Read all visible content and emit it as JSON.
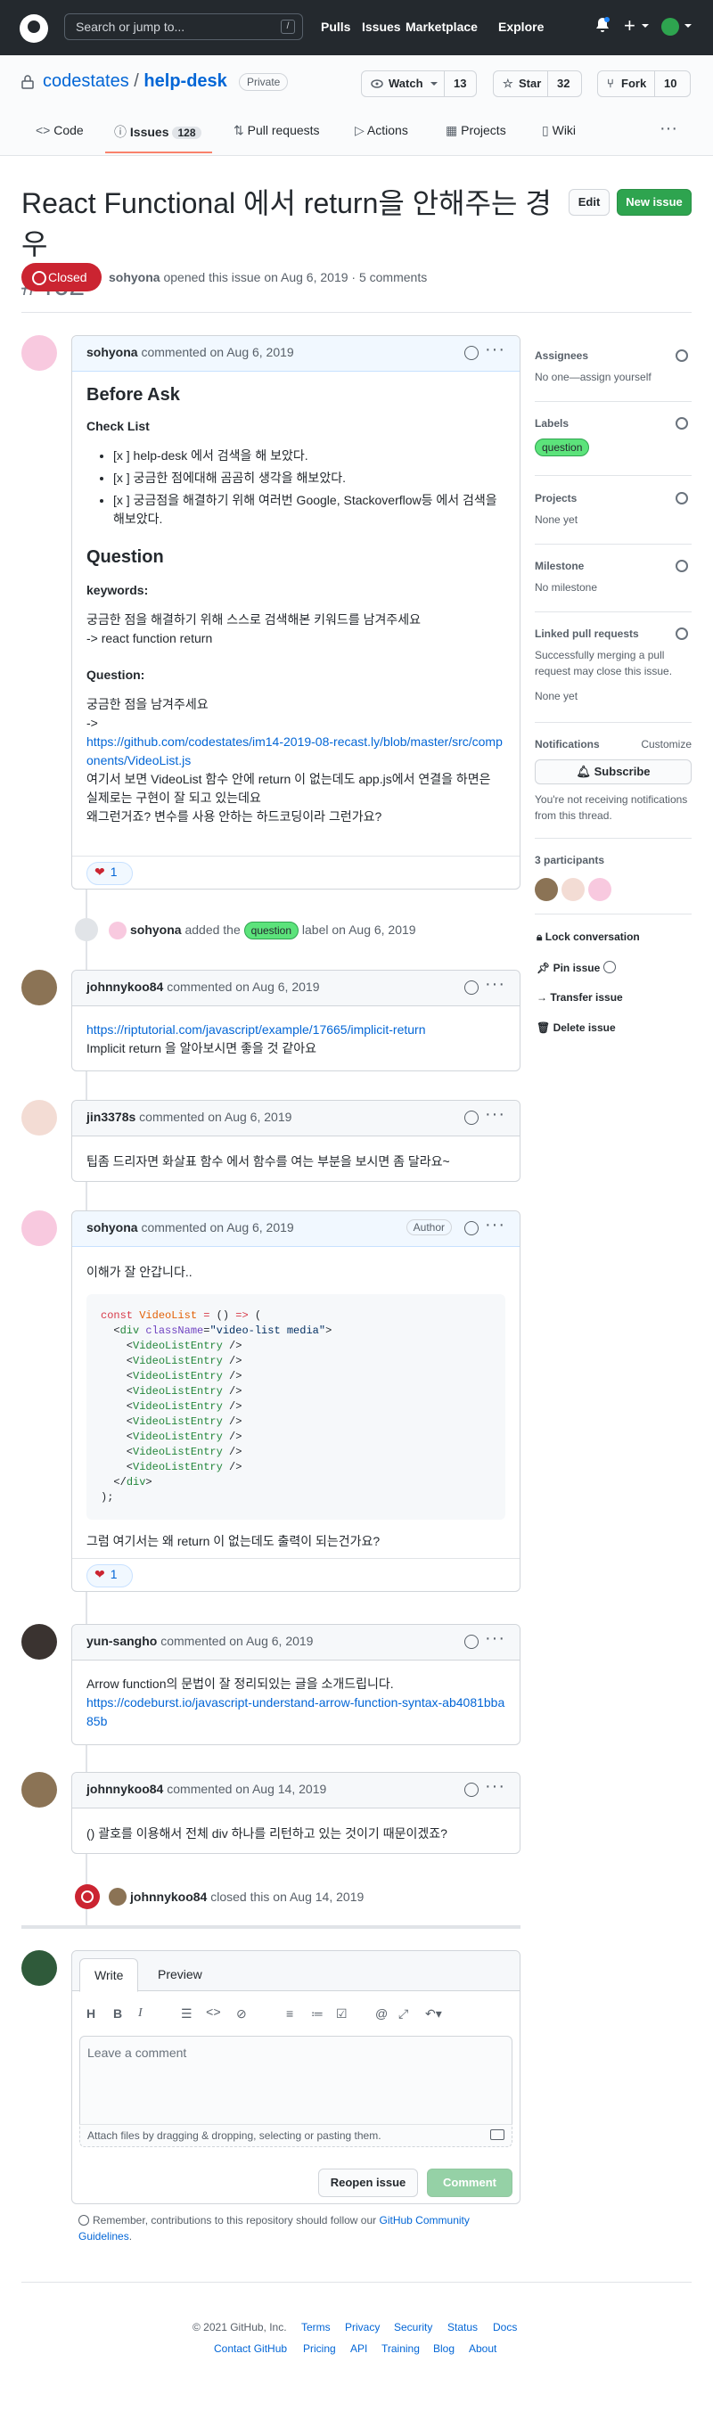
{
  "header": {
    "search_placeholder": "Search or jump to...",
    "search_key": "/",
    "nav": [
      "Pulls",
      "Issues",
      "Marketplace",
      "Explore"
    ]
  },
  "repo": {
    "owner": "codestates",
    "sep": "/",
    "name": "help-desk",
    "visibility": "Private",
    "watch_label": "Watch",
    "watch_count": "13",
    "star_label": "Star",
    "star_count": "32",
    "fork_label": "Fork",
    "fork_count": "10",
    "tabs": {
      "code": "Code",
      "issues": "Issues",
      "issues_count": "128",
      "pulls": "Pull requests",
      "actions": "Actions",
      "projects": "Projects",
      "wiki": "Wiki"
    }
  },
  "issue": {
    "title": "React Functional 에서 return을 안해주는 경우",
    "number": "#462",
    "edit": "Edit",
    "new_issue": "New issue",
    "state": "Closed",
    "meta_author": "sohyona",
    "meta_rest": " opened this issue on Aug 6, 2019 · 5 comments"
  },
  "comments": {
    "c1": {
      "author": "sohyona",
      "meta": " commented on Aug 6, 2019",
      "h_before": "Before Ask",
      "h_checklist": "Check List",
      "checks": [
        "[x ] help-desk 에서 검색을 해 보았다.",
        "[x ] 궁금한 점에대해 곰곰히 생각을 해보았다.",
        "[x ] 궁금점을 해결하기 위해 여러번 Google, Stackoverflow등 에서 검색을 해보았다."
      ],
      "h_question": "Question",
      "h_keywords": "keywords:",
      "kw_line1": "궁금한 점을 해결하기 위해 스스로 검색해본 키워드를 남겨주세요",
      "kw_line2": "-> react function return",
      "h_question2": "Question:",
      "q_line1": "궁금한 점을 남겨주세요",
      "q_line2": "->",
      "q_link": "https://github.com/codestates/im14-2019-08-recast.ly/blob/master/src/components/VideoList.js",
      "q_line3": "여기서 보면 VideoList 함수 안에 return 이 없는데도 app.js에서 연결을 하면은 실제로는 구현이 잘 되고 있는데요",
      "q_line4": "왜그런거죠? 변수를 사용 안하는 하드코딩이라 그런가요?",
      "reaction": "1"
    },
    "label_event": {
      "actor": "sohyona",
      "pre": " added the ",
      "label": "question",
      "post": " label on Aug 6, 2019"
    },
    "c2": {
      "author": "johnnykoo84",
      "meta": " commented on Aug 6, 2019",
      "link": "https://riptutorial.com/javascript/example/17665/implicit-return",
      "text": "Implicit return 을 알아보시면 좋을 것 같아요"
    },
    "c3": {
      "author": "jin3378s",
      "meta": " commented on Aug 6, 2019",
      "text": "팁좀 드리자면 화살표 함수 에서 함수를 여는 부분을 보시면 좀 달라요~"
    },
    "c4": {
      "author": "sohyona",
      "meta": " commented on Aug 6, 2019",
      "badge": "Author",
      "text1": "이해가 잘 안갑니다..",
      "code_lines": [
        "const VideoList = () => (",
        "  <div className=\"video-list media\">",
        "    <VideoListEntry />",
        "    <VideoListEntry />",
        "    <VideoListEntry />",
        "    <VideoListEntry />",
        "    <VideoListEntry />",
        "    <VideoListEntry />",
        "    <VideoListEntry />",
        "    <VideoListEntry />",
        "    <VideoListEntry />",
        "  </div>",
        ");"
      ],
      "text2": "그럼 여기서는 왜 return 이 없는데도 출력이 되는건가요?",
      "reaction": "1"
    },
    "c5": {
      "author": "yun-sangho",
      "meta": " commented on Aug 6, 2019",
      "text": "Arrow function의 문법이 잘 정리되있는 글을 소개드립니다.",
      "link": "https://codeburst.io/javascript-understand-arrow-function-syntax-ab4081bba85b"
    },
    "c6": {
      "author": "johnnykoo84",
      "meta": " commented on Aug 14, 2019",
      "text": "() 괄호를 이용해서 전체 div 하나를 리턴하고 있는 것이기 때문이겠죠?"
    },
    "closed_event": {
      "actor": "johnnykoo84",
      "rest": " closed this on Aug 14, 2019"
    }
  },
  "sidebar": {
    "assignees_t": "Assignees",
    "assignees_v": "No one—assign yourself",
    "labels_t": "Labels",
    "labels_v": "question",
    "projects_t": "Projects",
    "projects_v": "None yet",
    "milestone_t": "Milestone",
    "milestone_v": "No milestone",
    "linked_t": "Linked pull requests",
    "linked_v": "Successfully merging a pull request may close this issue.",
    "linked_v2": "None yet",
    "notif_t": "Notifications",
    "notif_customize": "Customize",
    "subscribe": "Subscribe",
    "notif_v": "You're not receiving notifications from this thread.",
    "participants_t": "3 participants",
    "lock": "Lock conversation",
    "pin": "Pin issue",
    "transfer": "Transfer issue",
    "delete": "Delete issue"
  },
  "form": {
    "tab_write": "Write",
    "tab_preview": "Preview",
    "placeholder": "Leave a comment",
    "attach": "Attach files by dragging & dropping, selecting or pasting them.",
    "reopen": "Reopen issue",
    "comment": "Comment",
    "note_pre": "Remember, contributions to this repository should follow our ",
    "note_link": "GitHub Community Guidelines",
    "note_post": "."
  },
  "footer": {
    "copyright": "© 2021 GitHub, Inc.",
    "row1": [
      "Terms",
      "Privacy",
      "Security",
      "Status",
      "Docs"
    ],
    "row2": [
      "Contact GitHub",
      "Pricing",
      "API",
      "Training",
      "Blog",
      "About"
    ]
  },
  "colors": {
    "header": "#24292e",
    "closed": "#cb2431",
    "green": "#2ea44f",
    "link": "#0366d6",
    "label_question": "#5ce37b"
  }
}
